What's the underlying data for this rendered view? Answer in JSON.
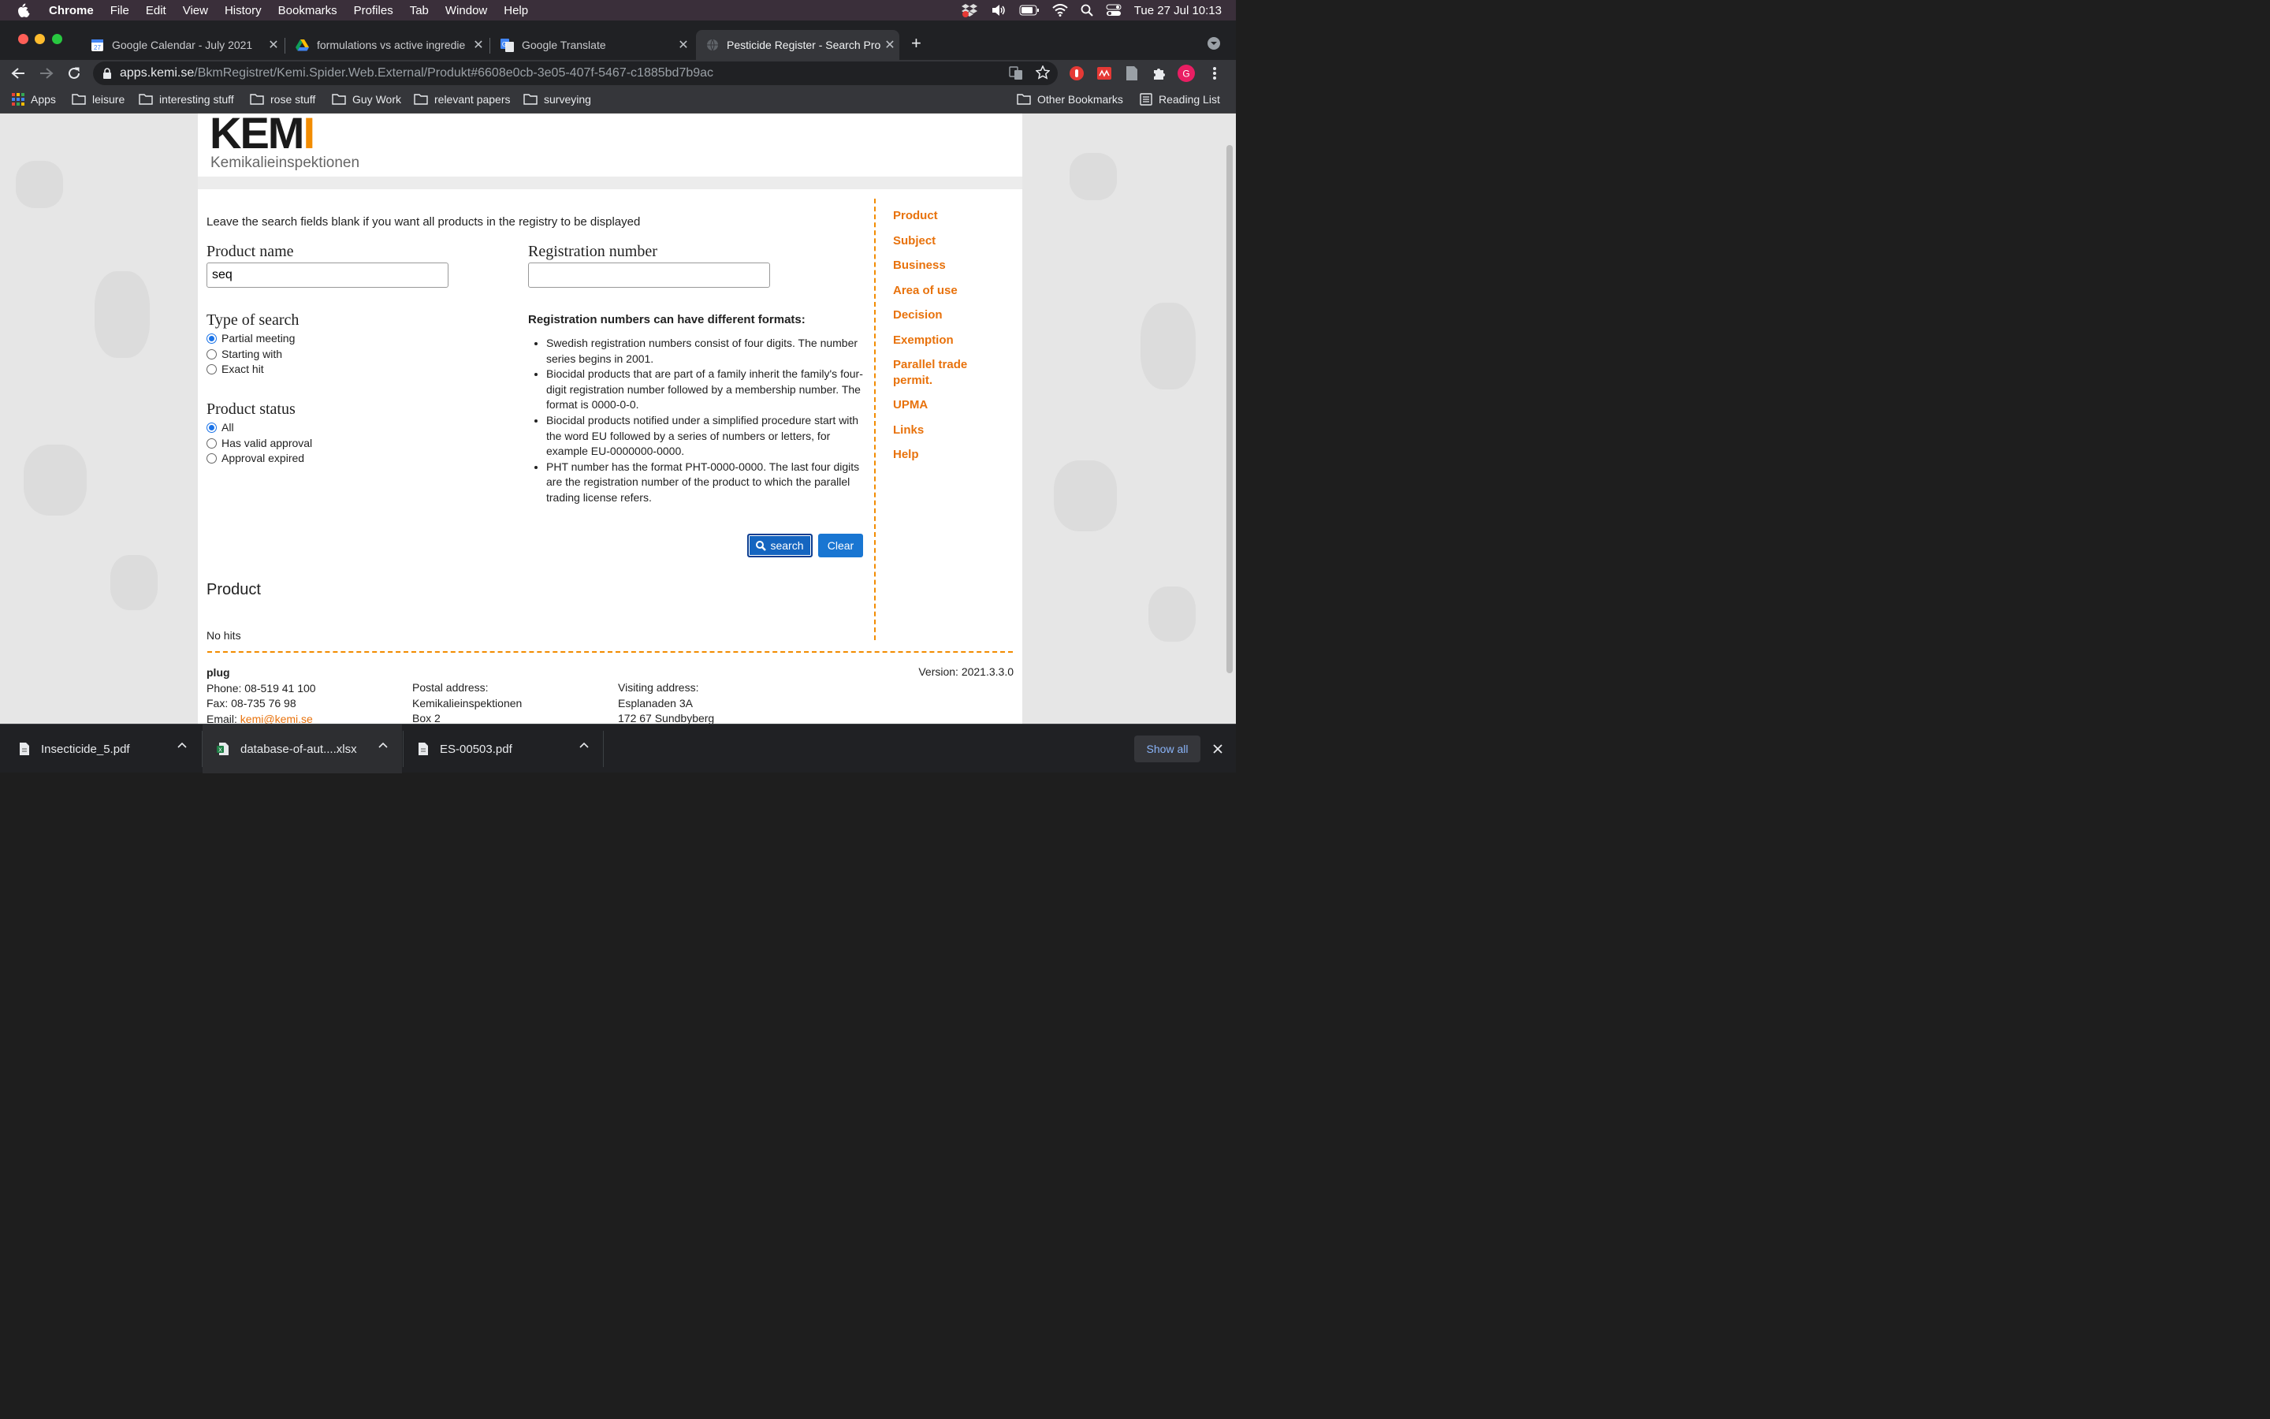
{
  "menubar": {
    "app": "Chrome",
    "items": [
      "File",
      "Edit",
      "View",
      "History",
      "Bookmarks",
      "Profiles",
      "Tab",
      "Window",
      "Help"
    ],
    "clock": "Tue 27 Jul  10:13"
  },
  "tabs": [
    {
      "title": "Google Calendar - July 2021",
      "favicon": "calendar-icon"
    },
    {
      "title": "formulations vs active ingredie",
      "favicon": "drive-icon"
    },
    {
      "title": "Google Translate",
      "favicon": "translate-icon"
    },
    {
      "title": "Pesticide Register - Search Pro",
      "favicon": "globe-icon"
    }
  ],
  "omnibox": {
    "host": "apps.kemi.se",
    "path": "/BkmRegistret/Kemi.Spider.Web.External/Produkt#6608e0cb-3e05-407f-5467-c1885bd7b9ac"
  },
  "bookmarks": {
    "apps": "Apps",
    "items": [
      "leisure",
      "interesting stuff",
      "rose stuff",
      "Guy Work",
      "relevant papers",
      "surveying"
    ],
    "other": "Other Bookmarks",
    "reading_list": "Reading List"
  },
  "logo": {
    "main": "KEM",
    "i": "I",
    "sub": "Kemikalieinspektionen"
  },
  "form": {
    "intro": "Leave the search fields blank if you want all products in the registry to be displayed",
    "product_name_label": "Product name",
    "product_name_value": "seq",
    "registration_number_label": "Registration number",
    "registration_number_value": "",
    "type_of_search_label": "Type of search",
    "type_of_search_options": [
      "Partial meeting",
      "Starting with",
      "Exact hit"
    ],
    "type_of_search_selected": "Partial meeting",
    "product_status_label": "Product status",
    "product_status_options": [
      "All",
      "Has valid approval",
      "Approval expired"
    ],
    "product_status_selected": "All",
    "formats_title": "Registration numbers can have different formats:",
    "formats": [
      "Swedish registration numbers consist of four digits. The number series begins in 2001.",
      "Biocidal products that are part of a family inherit the family's four-digit registration number followed by a membership number. The format is 0000-0-0.",
      "Biocidal products notified under a simplified procedure start with the word EU followed by a series of numbers or letters, for example EU-0000000-0000.",
      "PHT number has the format PHT-0000-0000. The last four digits are the registration number of the product to which the parallel trading license refers."
    ],
    "search_label": "search",
    "clear_label": "Clear"
  },
  "sidenav": [
    "Product",
    "Subject",
    "Business",
    "Area of use",
    "Decision",
    "Exemption",
    "Parallel trade permit.",
    "UPMA",
    "Links",
    "Help"
  ],
  "results": {
    "heading": "Product",
    "message": "No hits"
  },
  "footer": {
    "org": "plug",
    "phone": "Phone: 08-519 41 100",
    "fax": "Fax: 08-735 76 98",
    "email_label": "Email: ",
    "email": "kemi@kemi.se",
    "postal_label": "Postal address:",
    "postal_1": "Kemikalieinspektionen",
    "postal_2": "Box 2",
    "visiting_label": "Visiting address:",
    "visiting_1": "Esplanaden 3A",
    "visiting_2": "172 67 Sundbyberg",
    "version": "Version: 2021.3.3.0"
  },
  "downloads": {
    "items": [
      "Insecticide_5.pdf",
      "database-of-aut....xlsx",
      "ES-00503.pdf"
    ],
    "show_all": "Show all"
  },
  "colors": {
    "accent_orange": "#f28c00",
    "link_orange": "#e8720c",
    "button_blue": "#1565c0"
  }
}
